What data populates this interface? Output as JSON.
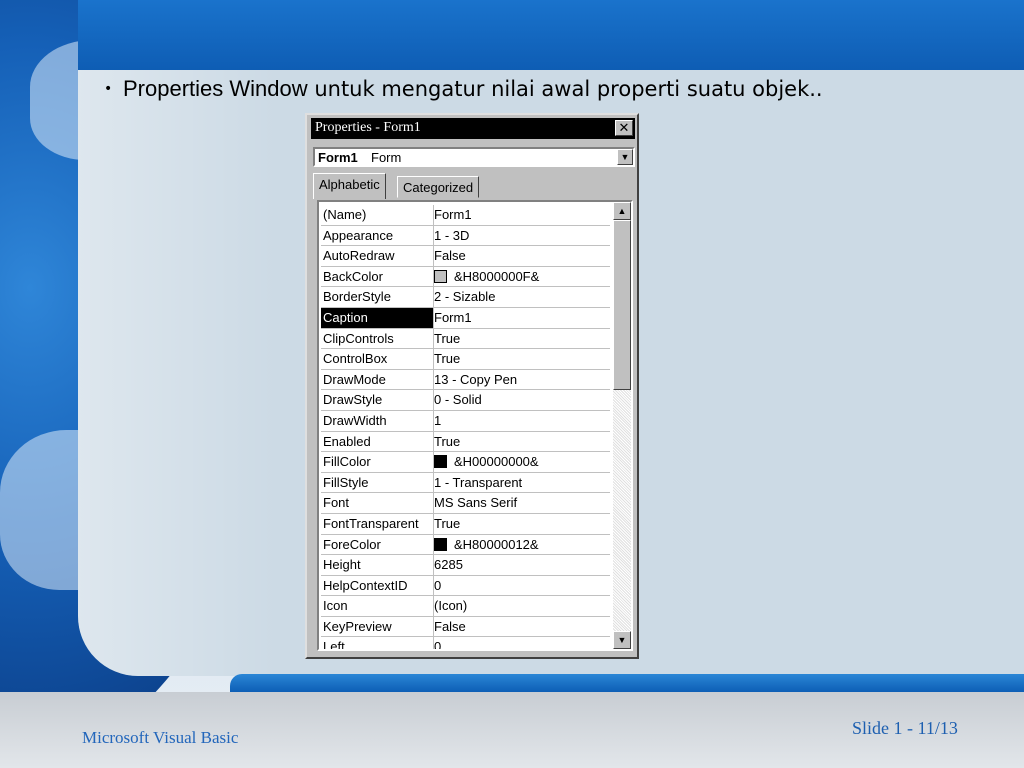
{
  "slide": {
    "bullet_strong": "Properties Window",
    "bullet_rest": "untuk mengatur nilai awal properti suatu objek..",
    "footer_left": "Microsoft Visual Basic",
    "footer_right": "Slide 1 - 11/13"
  },
  "window": {
    "title": "Properties - Form1",
    "object_name": "Form1",
    "object_type": "Form",
    "tabs": [
      {
        "label": "Alphabetic",
        "active": true
      },
      {
        "label": "Categorized",
        "active": false
      }
    ],
    "properties": [
      {
        "name": "(Name)",
        "value": "Form1"
      },
      {
        "name": "Appearance",
        "value": "1 - 3D"
      },
      {
        "name": "AutoRedraw",
        "value": "False"
      },
      {
        "name": "BackColor",
        "value": "&H8000000F&",
        "swatch": "#c0c0c0"
      },
      {
        "name": "BorderStyle",
        "value": "2 - Sizable"
      },
      {
        "name": "Caption",
        "value": "Form1",
        "selected": true
      },
      {
        "name": "ClipControls",
        "value": "True"
      },
      {
        "name": "ControlBox",
        "value": "True"
      },
      {
        "name": "DrawMode",
        "value": "13 - Copy Pen"
      },
      {
        "name": "DrawStyle",
        "value": "0 - Solid"
      },
      {
        "name": "DrawWidth",
        "value": "1"
      },
      {
        "name": "Enabled",
        "value": "True"
      },
      {
        "name": "FillColor",
        "value": "&H00000000&",
        "swatch": "#000000"
      },
      {
        "name": "FillStyle",
        "value": "1 - Transparent"
      },
      {
        "name": "Font",
        "value": "MS Sans Serif"
      },
      {
        "name": "FontTransparent",
        "value": "True"
      },
      {
        "name": "ForeColor",
        "value": "&H80000012&",
        "swatch": "#000000"
      },
      {
        "name": "Height",
        "value": "6285"
      },
      {
        "name": "HelpContextID",
        "value": "0"
      },
      {
        "name": "Icon",
        "value": "(Icon)"
      },
      {
        "name": "KeyPreview",
        "value": "False"
      },
      {
        "name": "Left",
        "value": "0"
      }
    ]
  },
  "icons": {
    "close": "close-icon",
    "dropdown": "dropdown-arrow-icon",
    "scroll_up": "scroll-up-arrow-icon",
    "scroll_down": "scroll-down-arrow-icon"
  }
}
